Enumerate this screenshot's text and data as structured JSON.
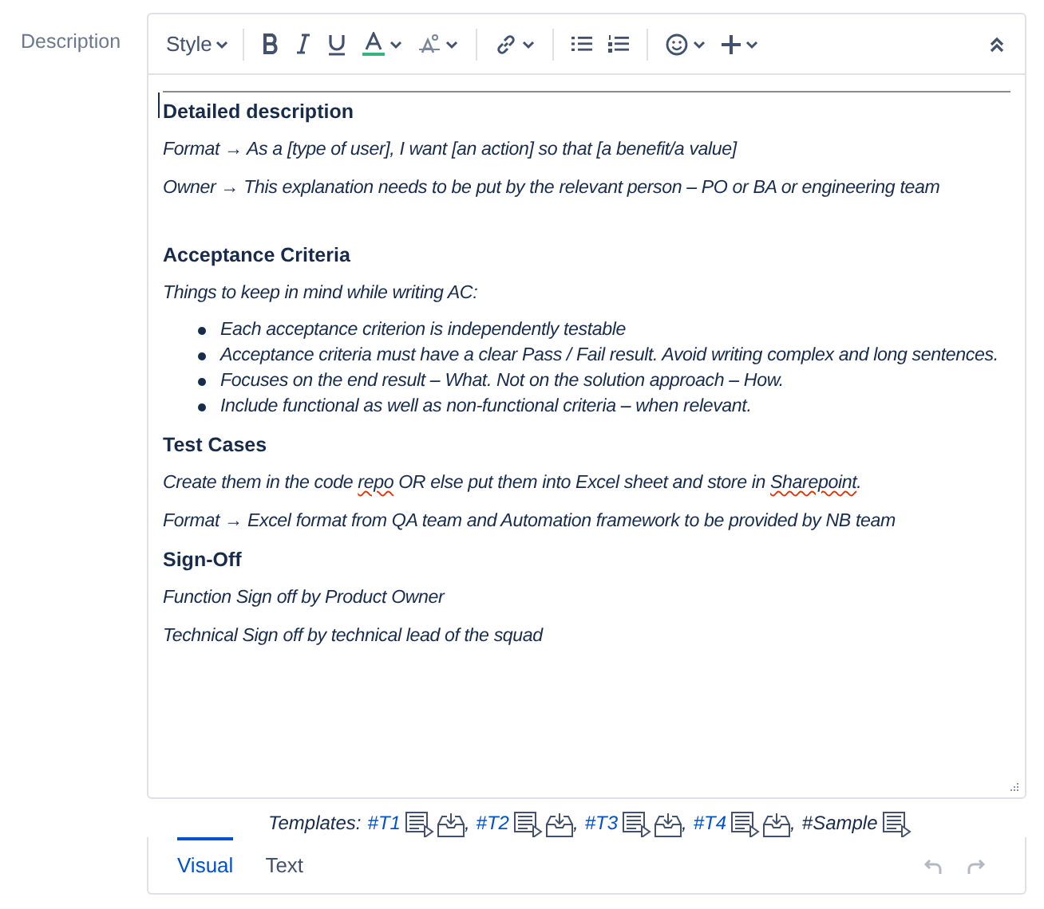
{
  "field_label": "Description",
  "toolbar": {
    "style_label": "Style"
  },
  "content": [
    {
      "kind": "heading",
      "text": "Detailed description"
    },
    {
      "kind": "para",
      "segments": [
        {
          "text": "Format → As a [type of user], I want [an action] so that [a benefit/a value]",
          "misspelled": false
        }
      ]
    },
    {
      "kind": "para",
      "segments": [
        {
          "text": "Owner → This explanation needs to be put by the relevant person – PO or BA or engineering team",
          "misspelled": false
        }
      ]
    },
    {
      "kind": "spacer"
    },
    {
      "kind": "heading",
      "text": "Acceptance Criteria"
    },
    {
      "kind": "para",
      "segments": [
        {
          "text": "Things to keep  in mind while writing AC:",
          "misspelled": false
        }
      ]
    },
    {
      "kind": "list",
      "items": [
        "Each acceptance criterion is independently testable",
        " Acceptance criteria must have a clear Pass / Fail result. Avoid writing complex and long sentences.",
        "Focuses on the end result – What. Not on the solution approach – How.",
        "Include functional as well as non-functional criteria – when relevant."
      ]
    },
    {
      "kind": "heading",
      "text": "Test Cases"
    },
    {
      "kind": "para",
      "segments": [
        {
          "text": "Create them in the code ",
          "misspelled": false
        },
        {
          "text": "repo",
          "misspelled": true
        },
        {
          "text": " OR else put them into Excel sheet and store in ",
          "misspelled": false
        },
        {
          "text": "Sharepoint",
          "misspelled": true
        },
        {
          "text": ".",
          "misspelled": false
        }
      ]
    },
    {
      "kind": "para",
      "segments": [
        {
          "text": "Format → Excel format from QA team and Automation framework to be provided by NB team",
          "misspelled": false
        }
      ]
    },
    {
      "kind": "heading",
      "text": "Sign-Off"
    },
    {
      "kind": "para",
      "segments": [
        {
          "text": "Function Sign off by Product Owner",
          "misspelled": false
        }
      ]
    },
    {
      "kind": "para",
      "segments": [
        {
          "text": "Technical Sign off by technical lead of the squad",
          "misspelled": false
        }
      ]
    }
  ],
  "templates": {
    "label": "Templates:",
    "items": [
      {
        "text": "#T1",
        "linked": true,
        "download": true,
        "separator": ","
      },
      {
        "text": "#T2",
        "linked": true,
        "download": true,
        "separator": ","
      },
      {
        "text": "#T3",
        "linked": true,
        "download": true,
        "separator": ","
      },
      {
        "text": "#T4",
        "linked": true,
        "download": true,
        "separator": ","
      },
      {
        "text": "#Sample",
        "linked": false,
        "download": false
      }
    ]
  },
  "tabs": [
    {
      "label": "Visual",
      "selected": true
    },
    {
      "label": "Text",
      "selected": false
    }
  ],
  "history": {
    "undo_disabled": true,
    "redo_disabled": true
  }
}
